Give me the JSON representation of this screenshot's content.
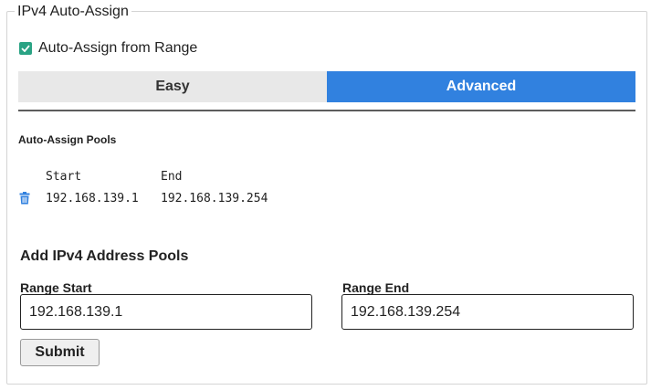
{
  "section": {
    "legend": "IPv4 Auto-Assign"
  },
  "auto_assign": {
    "label": "Auto-Assign from Range",
    "checked": true,
    "color": "#2aa384"
  },
  "mode_toggle": {
    "easy_label": "Easy",
    "advanced_label": "Advanced",
    "active": "Advanced",
    "accent": "#3181df"
  },
  "pools": {
    "title": "Auto-Assign Pools",
    "columns": [
      "Start",
      "End"
    ],
    "rows": [
      {
        "start": "192.168.139.1",
        "end": "192.168.139.254",
        "delete_icon": "trash-icon"
      }
    ]
  },
  "add_pool": {
    "title": "Add IPv4 Address Pools",
    "range_start_label": "Range Start",
    "range_start_value": "192.168.139.1",
    "range_end_label": "Range End",
    "range_end_value": "192.168.139.254",
    "submit_label": "Submit"
  }
}
